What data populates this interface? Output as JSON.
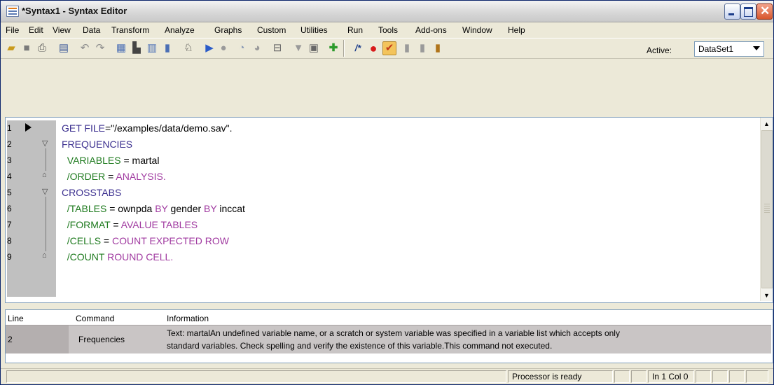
{
  "window": {
    "title": "*Syntax1 - Syntax Editor"
  },
  "menu": [
    "File",
    "Edit",
    "View",
    "Data",
    "Transform",
    "Analyze",
    "Graphs",
    "Custom",
    "Utilities",
    "Run",
    "Tools",
    "Add-ons",
    "Window",
    "Help"
  ],
  "toolbar": {
    "icons": [
      "open-icon",
      "save-icon",
      "print-icon",
      "dialog-recall-icon",
      "undo-icon",
      "redo-icon",
      "goto-data-icon",
      "goto-case-icon",
      "goto-variable-icon",
      "variables-icon",
      "find-icon",
      "run-selection-icon",
      "stop-icon",
      "step-icon",
      "step-through-icon",
      "wrap-icon",
      "syntax-help-icon",
      "validate-icon",
      "add-icon",
      "comment-icon",
      "breakpoint-icon",
      "bookmark-icon",
      "bookmark-next-icon",
      "bookmark-prev-icon",
      "bookmark-clear-icon"
    ],
    "active_label": "Active:",
    "dataset": "DataSet1"
  },
  "code": {
    "lines": [
      {
        "num": "1",
        "segments": [
          [
            "GET FILE",
            "cmd"
          ],
          [
            "=\"/examples/data/demo.sav\".",
            "txt"
          ]
        ]
      },
      {
        "num": "2",
        "segments": [
          [
            "FREQUENCIES",
            "cmd"
          ]
        ]
      },
      {
        "num": "3",
        "segments": [
          [
            "  VARIABLES",
            "sub"
          ],
          [
            " = ",
            "txt"
          ],
          [
            "martal",
            "txt"
          ]
        ]
      },
      {
        "num": "4",
        "segments": [
          [
            "  /ORDER",
            "sub"
          ],
          [
            " = ",
            "txt"
          ],
          [
            "ANALYSIS.",
            "kw"
          ]
        ]
      },
      {
        "num": "5",
        "segments": [
          [
            "CROSSTABS",
            "cmd"
          ]
        ]
      },
      {
        "num": "6",
        "segments": [
          [
            "  /TABLES",
            "sub"
          ],
          [
            " = ownpda ",
            "txt"
          ],
          [
            "BY",
            "kw"
          ],
          [
            " gender ",
            "txt"
          ],
          [
            "BY",
            "kw"
          ],
          [
            " inccat",
            "txt"
          ]
        ]
      },
      {
        "num": "7",
        "segments": [
          [
            "  /FORMAT",
            "sub"
          ],
          [
            " = ",
            "txt"
          ],
          [
            "AVALUE TABLES",
            "kw"
          ]
        ]
      },
      {
        "num": "8",
        "segments": [
          [
            "  /CELLS",
            "sub"
          ],
          [
            " = ",
            "txt"
          ],
          [
            "COUNT EXPECTED ROW",
            "kw"
          ]
        ]
      },
      {
        "num": "9",
        "segments": [
          [
            "  /COUNT ",
            "sub"
          ],
          [
            "ROUND CELL.",
            "kw"
          ]
        ]
      }
    ]
  },
  "errors": {
    "headers": {
      "line": "Line",
      "command": "Command",
      "info": "Information"
    },
    "rows": [
      {
        "line": "2",
        "command": "Frequencies",
        "info_line1": "Text: martalAn undefined variable name, or a scratch or system variable was specified in a variable list which accepts only",
        "info_line2": "standard variables.  Check spelling and verify the existence of this variable.This command not executed."
      }
    ]
  },
  "status": {
    "processor": "Processor is ready",
    "position": "In 1 Col 0"
  },
  "colors": {
    "cmd": "#3b2f8f",
    "sub": "#1e7a1e",
    "kw": "#a03aa0"
  }
}
